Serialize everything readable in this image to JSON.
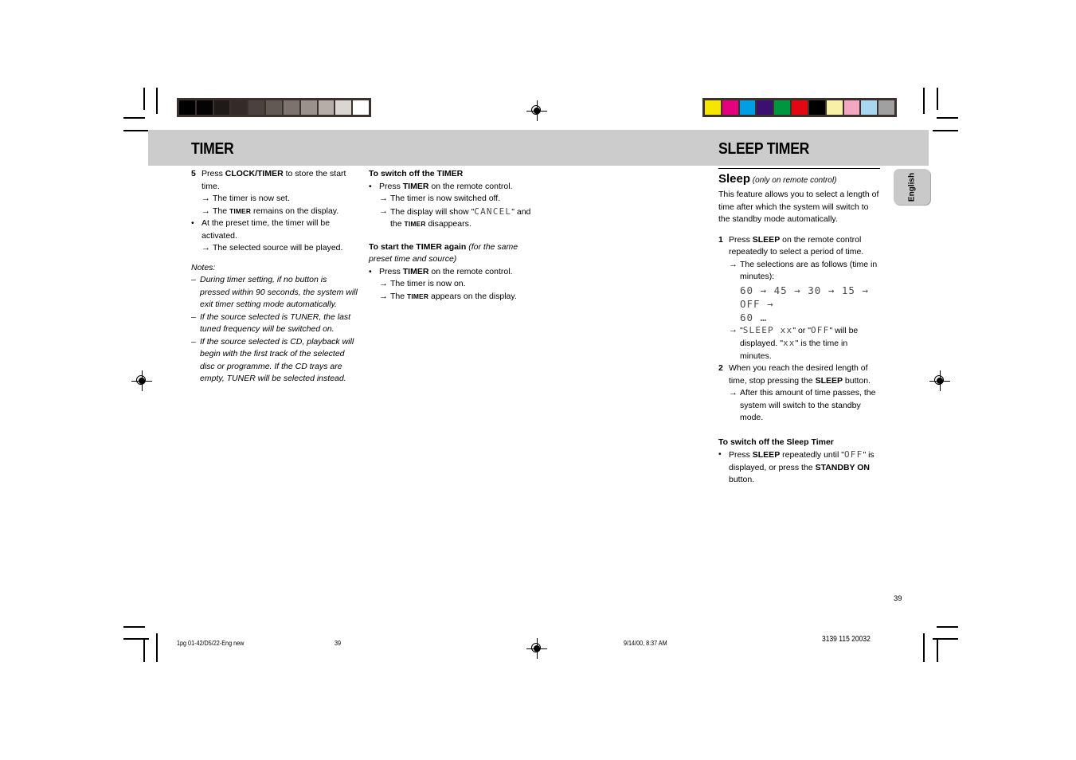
{
  "document": {
    "page_number": "39",
    "language_tab": "English"
  },
  "headers": {
    "left_title": "TIMER",
    "right_title": "SLEEP TIMER"
  },
  "calibration": {
    "gray_wedge": [
      "#000000",
      "#050303",
      "#1f1a18",
      "#332b27",
      "#4a423e",
      "#625955",
      "#7d726d",
      "#9a908c",
      "#b6aca8",
      "#dcd6d2",
      "#ffffff"
    ],
    "color_patches": [
      "#f5e500",
      "#e5007d",
      "#009fe3",
      "#3b1070",
      "#009640",
      "#e30613",
      "#000000",
      "#f9f0a8",
      "#f4a7c0",
      "#a9d7f2",
      "#a0a0a0"
    ]
  },
  "column_left": {
    "step5": {
      "marker": "5",
      "text_parts": [
        "Press ",
        "CLOCK/TIMER",
        " to store the start time."
      ],
      "plain": "Press CLOCK/TIMER to store the start time."
    },
    "step5_results": [
      "The timer is now set.",
      "The TIMER remains on the display."
    ],
    "result_timer_word": "TIMER",
    "result2_prefix": "The ",
    "result2_suffix": " remains on the display.",
    "bullet_preset": "At the preset time, the timer will be activated.",
    "bullet_preset_result": "The selected source will be played.",
    "notes_label": "Notes:",
    "notes": [
      "During timer setting, if no button is pressed within 90 seconds, the system will exit timer setting mode automatically.",
      "If the source selected is TUNER, the last tuned frequency will be switched on.",
      "If the source selected is CD, playback will begin with the first track of the selected disc or programme. If the CD trays are empty, TUNER will be selected instead."
    ]
  },
  "column_middle": {
    "switch_off": {
      "heading": "To switch off the TIMER",
      "bullet_prefix": "Press ",
      "bullet_bold": "TIMER",
      "bullet_suffix": " on the remote control.",
      "result1": "The timer is now switched off.",
      "result2_prefix": "The display will show \"",
      "result2_lcd": "CANCEL",
      "result2_mid": "\"",
      "result2_line2_prefix": "and the ",
      "result2_timer_word": "TIMER",
      "result2_line2_suffix": " disappears."
    },
    "start_again": {
      "heading_bold": "To start the TIMER again",
      "heading_italic": " (for the same preset time and source)",
      "bullet_prefix": "Press ",
      "bullet_bold": "TIMER",
      "bullet_suffix": " on the remote control.",
      "result1": "The timer is now on.",
      "result2_prefix": "The ",
      "result2_timer_word": "TIMER",
      "result2_suffix": " appears on the display."
    }
  },
  "column_right": {
    "sleep_heading": "Sleep",
    "sleep_heading_note": " (only on remote control)",
    "intro": "This feature allows you to select a length of time after which the system will switch to the standby mode automatically.",
    "step1": {
      "marker": "1",
      "prefix": "Press ",
      "bold": "SLEEP",
      "suffix": " on the remote control repeatedly to select a period of time.",
      "result1": "The selections are as follows (time in minutes):",
      "sequence_line1": "60 → 45 → 30 → 15 → OFF →",
      "sequence_line2": "60 …",
      "result2_prefix": "\"",
      "result2_lcd1": "SLEEP xx",
      "result2_mid": "\" or \"",
      "result2_lcd2": "OFF",
      "result2_suffix": "\" will be displayed. \"",
      "result2_lcd3": "xx",
      "result2_tail": "\" is the time in minutes."
    },
    "step2": {
      "marker": "2",
      "prefix": "When you reach the desired length of time, stop pressing the ",
      "bold": "SLEEP",
      "suffix": " button.",
      "result1": "After this amount of time passes, the system will switch to the standby mode."
    },
    "switch_off": {
      "heading": "To switch off the Sleep Timer",
      "bullet_prefix": "Press ",
      "bullet_bold1": "SLEEP",
      "bullet_mid1": " repeatedly until \"",
      "bullet_lcd": "OFF",
      "bullet_mid2": "\" is displayed, or press the ",
      "bullet_bold2": "STANDBY ON",
      "bullet_suffix": " button."
    }
  },
  "footer": {
    "file_label": "1pg 01-42/D5/22-Eng new",
    "page": "39",
    "timestamp": "9/14/00, 8:37 AM",
    "code": "3139 115 20032"
  }
}
